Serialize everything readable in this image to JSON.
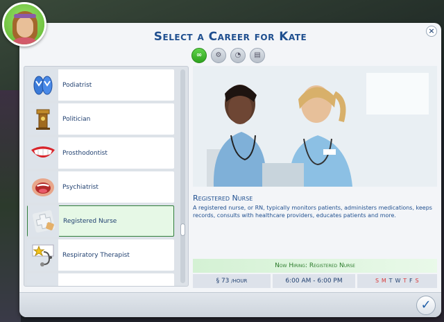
{
  "dialog": {
    "title": "Select a Career for Kate",
    "close_label": "×",
    "confirm_label": "✓"
  },
  "tabs": [
    {
      "label": "∞",
      "icon": "infinity-icon",
      "active": true
    },
    {
      "label": "⚙",
      "icon": "active-career-icon",
      "active": false
    },
    {
      "label": "◔",
      "icon": "part-time-icon",
      "active": false
    },
    {
      "label": "▤",
      "icon": "odd-job-icon",
      "active": false
    }
  ],
  "careers": [
    {
      "label": "Podiatrist",
      "icon": "flip-flops-icon"
    },
    {
      "label": "Politician",
      "icon": "podium-icon"
    },
    {
      "label": "Prosthodontist",
      "icon": "smile-teeth-icon"
    },
    {
      "label": "Psychiatrist",
      "icon": "open-mouth-icon"
    },
    {
      "label": "Registered Nurse",
      "icon": "medical-cross-icon",
      "selected": true
    },
    {
      "label": "Respiratory Therapist",
      "icon": "stethoscope-star-icon"
    },
    {
      "label": "",
      "icon": "partial-item-icon"
    }
  ],
  "detail": {
    "name": "Registered Nurse",
    "description": "A registered nurse, or RN, typically monitors patients, administers medications, keeps records, consults with healthcare providers, educates patients and more.",
    "hiring": "Now Hiring: Registered Nurse",
    "pay_symbol": "§",
    "pay_value": "73",
    "pay_unit": "/HOUR",
    "hours": "6:00 AM - 6:00 PM",
    "days": [
      {
        "d": "S",
        "off": true
      },
      {
        "d": "M",
        "off": true
      },
      {
        "d": "T",
        "off": false
      },
      {
        "d": "W",
        "off": false
      },
      {
        "d": "T",
        "off": true
      },
      {
        "d": "F",
        "off": false
      },
      {
        "d": "S",
        "off": true
      }
    ]
  },
  "colors": {
    "accent": "#1f4f8f",
    "hiring_green": "#2a7a2a",
    "selected_border": "#2f7d3a"
  }
}
